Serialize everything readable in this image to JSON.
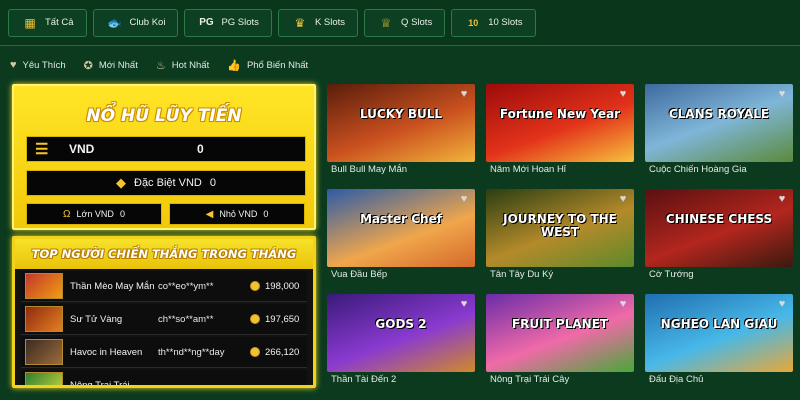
{
  "tabs": [
    {
      "label": "Tất Cả",
      "icon": "grid-icon"
    },
    {
      "label": "Club Koi",
      "icon": "koi-fish-icon"
    },
    {
      "label": "PG Slots",
      "icon": "pg-logo-icon"
    },
    {
      "label": "K Slots",
      "icon": "crown-icon"
    },
    {
      "label": "Q Slots",
      "icon": "crown-small-icon"
    },
    {
      "label": "10 Slots",
      "icon": "ten-badge-icon"
    }
  ],
  "filters": [
    {
      "label": "Yêu Thích",
      "icon": "heart-icon"
    },
    {
      "label": "Mới Nhất",
      "icon": "medal-icon"
    },
    {
      "label": "Hot Nhất",
      "icon": "flame-icon"
    },
    {
      "label": "Phổ Biến Nhất",
      "icon": "thumbs-up-icon"
    }
  ],
  "jackpot": {
    "title": "NỔ HŨ LŨY TIẾN",
    "currency": "VND",
    "amount": "0",
    "special_label": "Đặc Biệt VND",
    "special_amount": "0",
    "large_label": "Lớn VND",
    "large_amount": "0",
    "small_label": "Nhỏ VND",
    "small_amount": "0"
  },
  "winners": {
    "title": "TOP NGƯỜI CHIẾN THẮNG TRONG THÁNG",
    "rows": [
      {
        "game": "Thần Mèo May Mắn",
        "user": "co**eo**ym**",
        "amount": "198,000"
      },
      {
        "game": "Sư Tử Vàng",
        "user": "ch**so**am**",
        "amount": "197,650"
      },
      {
        "game": "Havoc in Heaven",
        "user": "th**nd**ng**day",
        "amount": "266,120"
      },
      {
        "game": "Nông Trại Trái",
        "user": "",
        "amount": ""
      }
    ]
  },
  "games": [
    {
      "name": "Bull Bull May Mắn",
      "logo": "LUCKY BULL"
    },
    {
      "name": "Năm Mới Hoan Hỉ",
      "logo": "Fortune New Year"
    },
    {
      "name": "Cuộc Chiến Hoàng Gia",
      "logo": "CLANS ROYALE"
    },
    {
      "name": "Vua Đầu Bếp",
      "logo": "Master Chef"
    },
    {
      "name": "Tân Tây Du Ký",
      "logo": "JOURNEY TO THE WEST"
    },
    {
      "name": "Cờ Tướng",
      "logo": "CHINESE CHESS"
    },
    {
      "name": "Thần Tài Đến 2",
      "logo": "GODS 2"
    },
    {
      "name": "Nông Trại Trái Cây",
      "logo": "FRUIT PLANET"
    },
    {
      "name": "Đấu Địa Chủ",
      "logo": "NGHEO LAN GIAU"
    }
  ]
}
